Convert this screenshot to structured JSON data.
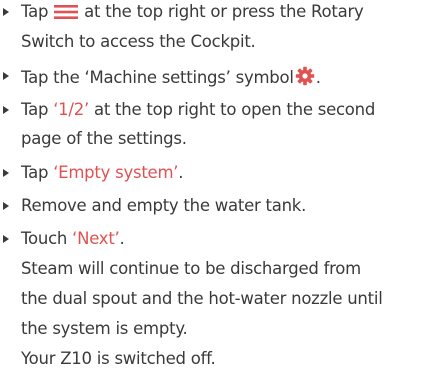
{
  "steps": [
    {
      "line1_a": "Tap ",
      "line1_b": " at the top right or press the Rotary",
      "line2": "Switch to access the Cockpit.",
      "icon": "menu-icon"
    },
    {
      "a": "Tap the ‘Machine settings’ symbol",
      "b": ".",
      "icon": "gear-icon"
    },
    {
      "a": "Tap ",
      "highlight": "‘1/2’",
      "b": " at the top right to open the second",
      "line2": "page of the settings."
    },
    {
      "a": "Tap ",
      "highlight": "‘Empty system’",
      "b": "."
    },
    {
      "text": "Remove and empty the water tank."
    },
    {
      "a": "Touch ",
      "highlight": "‘Next’",
      "b": ".",
      "result_lines": [
        "Steam will continue to be discharged from",
        "the dual spout and the hot-water nozzle until",
        "the system is empty.",
        "Your Z10 is switched off."
      ]
    }
  ],
  "colors": {
    "text": "#3a3a3a",
    "accent": "#e05252"
  }
}
